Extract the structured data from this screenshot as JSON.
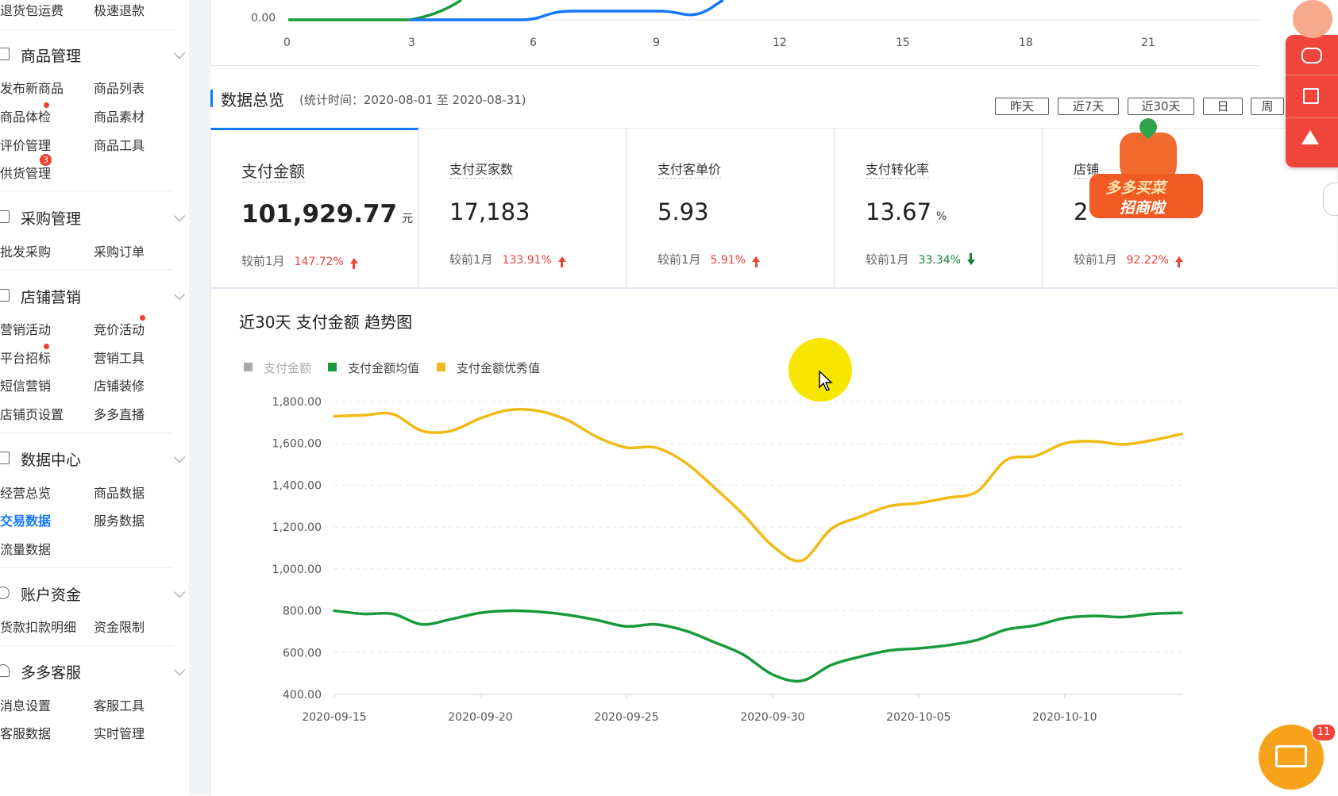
{
  "sidebar": {
    "top_items": [
      "退货包运费",
      "极速退款"
    ],
    "groups": [
      {
        "label": "商品管理",
        "icon": "product-icon",
        "items": [
          [
            "发布新商品",
            "商品列表"
          ],
          [
            "商品体检",
            "商品素材"
          ],
          [
            "评价管理",
            "商品工具"
          ],
          [
            "供货管理",
            ""
          ]
        ]
      },
      {
        "label": "采购管理",
        "icon": "purchase-icon",
        "items": [
          [
            "批发采购",
            "采购订单"
          ]
        ]
      },
      {
        "label": "店铺营销",
        "icon": "marketing-icon",
        "items": [
          [
            "营销活动",
            "竞价活动"
          ],
          [
            "平台招标",
            "营销工具"
          ],
          [
            "短信营销",
            "店铺装修"
          ],
          [
            "店铺页设置",
            "多多直播"
          ]
        ]
      },
      {
        "label": "数据中心",
        "icon": "data-icon",
        "items": [
          [
            "经营总览",
            "商品数据"
          ],
          [
            "交易数据",
            "服务数据"
          ],
          [
            "流量数据",
            ""
          ]
        ]
      },
      {
        "label": "账户资金",
        "icon": "yuan-icon",
        "items": [
          [
            "货款扣款明细",
            "资金限制"
          ]
        ]
      },
      {
        "label": "多多客服",
        "icon": "headset-icon",
        "items": [
          [
            "消息设置",
            "客服工具"
          ],
          [
            "客服数据",
            "实时管理"
          ]
        ]
      }
    ],
    "badge_supply": "3",
    "active_item": "交易数据"
  },
  "top_chart": {
    "y_label": "0.00",
    "x_ticks": [
      "0",
      "3",
      "6",
      "9",
      "12",
      "15",
      "18",
      "21"
    ]
  },
  "overview": {
    "title": "数据总览",
    "period": "(统计时间：2020-08-01 至 2020-08-31)",
    "ranges": [
      "昨天",
      "近7天",
      "近30天",
      "日",
      "周"
    ]
  },
  "cards": [
    {
      "title": "支付金额",
      "value": "101,929.77",
      "unit": "元",
      "cmp_label": "较前1月",
      "pct": "147.72%",
      "dir": "up"
    },
    {
      "title": "支付买家数",
      "value": "17,183",
      "unit": "",
      "cmp_label": "较前1月",
      "pct": "133.91%",
      "dir": "up"
    },
    {
      "title": "支付客单价",
      "value": "5.93",
      "unit": "",
      "cmp_label": "较前1月",
      "pct": "5.91%",
      "dir": "up"
    },
    {
      "title": "支付转化率",
      "value": "13.67",
      "unit": "%",
      "cmp_label": "较前1月",
      "pct": "33.34%",
      "dir": "down"
    },
    {
      "title": "店铺",
      "value": "2",
      "unit": "",
      "cmp_label": "较前1月",
      "pct": "92.22%",
      "dir": "up"
    }
  ],
  "promo": {
    "line1": "多多买菜",
    "line2": "招商啦"
  },
  "colors": {
    "up": "#e8453c",
    "down": "#1a7f37",
    "accent": "#1677ff",
    "green_series": "#1a9a3a",
    "yellow_series": "#f0bb14",
    "gray_series": "#aaaaaa"
  },
  "mail_badge": "11",
  "chart_data": {
    "type": "line",
    "title": "近30天 支付金额 趋势图",
    "legend": [
      "支付金额",
      "支付金额均值",
      "支付金额优秀值"
    ],
    "x_ticks": [
      "2020-09-15",
      "2020-09-20",
      "2020-09-25",
      "2020-09-30",
      "2020-10-05",
      "2020-10-10"
    ],
    "x": [
      "2020-09-15",
      "2020-09-16",
      "2020-09-17",
      "2020-09-18",
      "2020-09-19",
      "2020-09-20",
      "2020-09-21",
      "2020-09-22",
      "2020-09-23",
      "2020-09-24",
      "2020-09-25",
      "2020-09-26",
      "2020-09-27",
      "2020-09-28",
      "2020-09-29",
      "2020-09-30",
      "2020-10-01",
      "2020-10-02",
      "2020-10-03",
      "2020-10-04",
      "2020-10-05",
      "2020-10-06",
      "2020-10-07",
      "2020-10-08",
      "2020-10-09",
      "2020-10-10",
      "2020-10-11",
      "2020-10-12",
      "2020-10-13",
      "2020-10-14"
    ],
    "y_ticks": [
      "400.00",
      "600.00",
      "800.00",
      "1,000.00",
      "1,200.00",
      "1,400.00",
      "1,600.00",
      "1,800.00"
    ],
    "ylim": [
      400,
      1800
    ],
    "series": [
      {
        "name": "支付金额均值",
        "color": "#1a9a3a",
        "values": [
          800,
          785,
          785,
          735,
          760,
          790,
          800,
          795,
          780,
          755,
          725,
          735,
          705,
          650,
          590,
          495,
          465,
          540,
          580,
          610,
          620,
          635,
          660,
          710,
          730,
          765,
          775,
          770,
          785,
          790
        ]
      },
      {
        "name": "支付金额优秀值",
        "color": "#f0bb14",
        "values": [
          1730,
          1735,
          1740,
          1660,
          1660,
          1720,
          1760,
          1755,
          1710,
          1630,
          1580,
          1580,
          1510,
          1390,
          1260,
          1110,
          1040,
          1190,
          1250,
          1300,
          1315,
          1340,
          1370,
          1520,
          1540,
          1600,
          1610,
          1595,
          1615,
          1645
        ]
      }
    ]
  }
}
